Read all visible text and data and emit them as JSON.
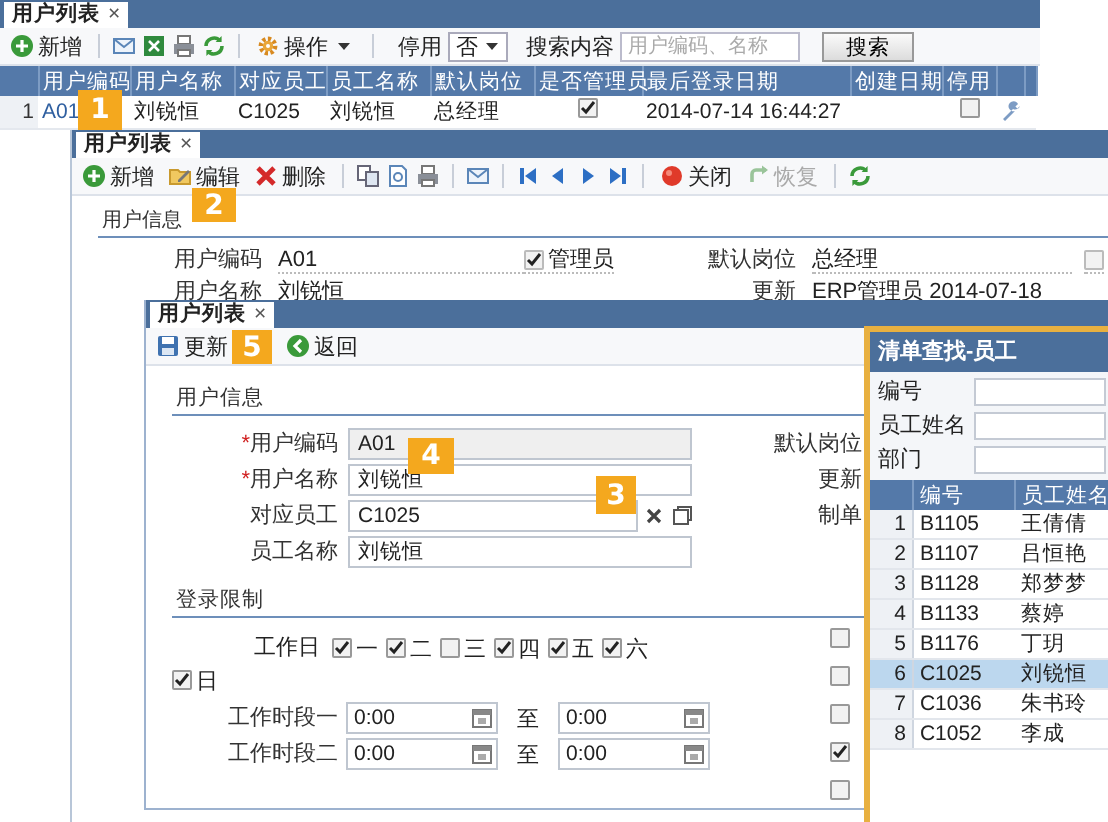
{
  "list_window": {
    "tab": {
      "label": "用户列表",
      "close": "×",
      "selected": true
    },
    "toolbar": [
      {
        "kind": "button",
        "label": "新增"
      },
      {
        "kind": "separator"
      },
      {
        "kind": "icon_button"
      },
      {
        "kind": "icon_button"
      },
      {
        "kind": "icon_button"
      },
      {
        "kind": "icon_button"
      },
      {
        "kind": "separator"
      },
      {
        "kind": "dropdown",
        "label": "操作"
      },
      {
        "kind": "separator"
      },
      {
        "kind": "label",
        "label": "停用"
      },
      {
        "kind": "select",
        "value": "否"
      },
      {
        "kind": "label",
        "label": "搜索内容"
      },
      {
        "kind": "search",
        "placeholder": "用户编码、名称"
      },
      {
        "kind": "push",
        "label": "搜索"
      }
    ],
    "table": {
      "columns": [
        "用户编码",
        "用户名称",
        "对应员工",
        "员工名称",
        "默认岗位",
        "是否管理员",
        "最后登录日期",
        "创建日期",
        "停用"
      ],
      "rows": [
        {
          "number": "1",
          "user_code": "A01",
          "user_name": "刘锐恒",
          "employee": "C1025",
          "employee_name": "刘锐恒",
          "default_post": "总经理",
          "admin": true,
          "last_login": "2014-07-14 16:44:27",
          "suspended": false
        }
      ]
    }
  },
  "edit_window": {
    "tab": {
      "label": "用户列表",
      "close": "×",
      "selected": true
    },
    "toolbar": [
      {
        "kind": "button",
        "label": "新增",
        "disabled": false
      },
      {
        "kind": "button",
        "label": "编辑",
        "disabled": false
      },
      {
        "kind": "button",
        "label": "删除",
        "disabled": false
      },
      {
        "kind": "separator"
      },
      {
        "kind": "icon_button"
      },
      {
        "kind": "icon_button"
      },
      {
        "kind": "icon_button"
      },
      {
        "kind": "separator"
      },
      {
        "kind": "icon_button"
      },
      {
        "kind": "separator"
      },
      {
        "kind": "icon_button"
      },
      {
        "kind": "icon_button"
      },
      {
        "kind": "icon_button"
      },
      {
        "kind": "icon_button"
      },
      {
        "kind": "separator"
      },
      {
        "kind": "button",
        "label": "关闭",
        "disabled": false
      },
      {
        "kind": "button",
        "label": "恢复",
        "disabled": true
      },
      {
        "kind": "separator"
      },
      {
        "kind": "icon_button"
      }
    ],
    "section": "用户信息",
    "columns": [
      [
        {
          "kind": "field",
          "label": "用户编码",
          "value": "A01"
        },
        {
          "kind": "field",
          "label": "用户名称",
          "value": "刘锐恒"
        }
      ],
      [
        {
          "kind": "checkbox",
          "label": "管理员",
          "checked": true
        }
      ],
      [
        {
          "kind": "field",
          "label": "默认岗位",
          "value": "总经理"
        },
        {
          "kind": "field",
          "label": "更新",
          "value": "ERP管理员 2014-07-18"
        }
      ],
      [
        {
          "kind": "checkbox",
          "checked": false
        }
      ]
    ]
  },
  "form_window": {
    "tab": {
      "label": "用户列表",
      "close": "×",
      "selected": true
    },
    "toolbar": [
      {
        "kind": "button",
        "label": "更新"
      },
      {
        "kind": "button",
        "label": "返回"
      }
    ],
    "user_section": {
      "title": "用户信息",
      "fields": [
        {
          "kind": "text",
          "label": "*用户编码",
          "required": true,
          "readonly": true,
          "value": "A01"
        },
        {
          "kind": "text",
          "label": "*用户名称",
          "required": true,
          "readonly": false,
          "value": "刘锐恒"
        },
        {
          "kind": "lookup",
          "label": "对应员工",
          "required": false,
          "readonly": false,
          "value": "C1025"
        },
        {
          "kind": "text",
          "label": "员工名称",
          "required": false,
          "readonly": false,
          "value": "刘锐恒"
        }
      ],
      "side_labels": [
        "默认岗位",
        "更新",
        "制单"
      ]
    },
    "login_section": {
      "title": "登录限制",
      "workday_label": "工作日",
      "days": [
        {
          "label": "一",
          "checked": true
        },
        {
          "label": "二",
          "checked": true
        },
        {
          "label": "三",
          "checked": false
        },
        {
          "label": "四",
          "checked": true
        },
        {
          "label": "五",
          "checked": true
        },
        {
          "label": "六",
          "checked": true
        },
        {
          "label": "日",
          "checked": true
        }
      ],
      "periods": [
        {
          "label": "工作时段一",
          "from": "0:00",
          "separator": "至",
          "to": "0:00"
        },
        {
          "label": "工作时段二",
          "from": "0:00",
          "separator": "至",
          "to": "0:00"
        }
      ],
      "options": [
        {
          "checked": false
        },
        {
          "checked": false
        },
        {
          "checked": false
        },
        {
          "checked": true
        },
        {
          "checked": false
        }
      ]
    }
  },
  "lookup_dialog": {
    "title": "清单查找-员工",
    "filters": [
      "编号",
      "员工姓名",
      "部门"
    ],
    "table": {
      "columns": [
        "编号",
        "员工姓名"
      ],
      "rows": [
        {
          "number": "1",
          "code": "B1105",
          "name": "王倩倩",
          "selected": false
        },
        {
          "number": "2",
          "code": "B1107",
          "name": "吕恒艳",
          "selected": false
        },
        {
          "number": "3",
          "code": "B1128",
          "name": "郑梦梦",
          "selected": false
        },
        {
          "number": "4",
          "code": "B1133",
          "name": "蔡婷",
          "selected": false
        },
        {
          "number": "5",
          "code": "B1176",
          "name": "丁玥",
          "selected": false
        },
        {
          "number": "6",
          "code": "C1025",
          "name": "刘锐恒",
          "selected": true
        },
        {
          "number": "7",
          "code": "C1036",
          "name": "朱书玲",
          "selected": false
        },
        {
          "number": "8",
          "code": "C1052",
          "name": "李成",
          "selected": false
        }
      ]
    }
  },
  "callouts": [
    {
      "number": "1"
    },
    {
      "number": "2"
    },
    {
      "number": "3"
    },
    {
      "number": "4"
    },
    {
      "number": "5"
    }
  ]
}
